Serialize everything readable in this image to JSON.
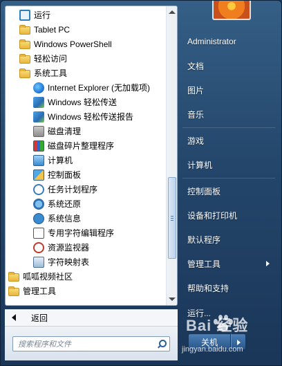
{
  "programs": [
    {
      "label": "运行",
      "icon": "run-icon",
      "indent": 0
    },
    {
      "label": "Tablet PC",
      "icon": "folder-icon",
      "indent": 0
    },
    {
      "label": "Windows PowerShell",
      "icon": "folder-icon",
      "indent": 0
    },
    {
      "label": "轻松访问",
      "icon": "folder-icon",
      "indent": 0
    },
    {
      "label": "系统工具",
      "icon": "folder-icon",
      "indent": 0
    },
    {
      "label": "Internet Explorer (无加载项)",
      "icon": "internet-explorer-icon",
      "indent": 1
    },
    {
      "label": "Windows 轻松传送",
      "icon": "easy-transfer-icon",
      "indent": 1
    },
    {
      "label": "Windows 轻松传送报告",
      "icon": "easy-transfer-report-icon",
      "indent": 1
    },
    {
      "label": "磁盘清理",
      "icon": "disk-cleanup-icon",
      "indent": 1
    },
    {
      "label": "磁盘碎片整理程序",
      "icon": "disk-defragmenter-icon",
      "indent": 1
    },
    {
      "label": "计算机",
      "icon": "computer-icon",
      "indent": 1
    },
    {
      "label": "控制面板",
      "icon": "control-panel-icon",
      "indent": 1
    },
    {
      "label": "任务计划程序",
      "icon": "task-scheduler-icon",
      "indent": 1
    },
    {
      "label": "系统还原",
      "icon": "system-restore-icon",
      "indent": 1
    },
    {
      "label": "系统信息",
      "icon": "system-information-icon",
      "indent": 1
    },
    {
      "label": "专用字符编辑程序",
      "icon": "private-character-editor-icon",
      "indent": 1
    },
    {
      "label": "资源监视器",
      "icon": "resource-monitor-icon",
      "indent": 1
    },
    {
      "label": "字符映射表",
      "icon": "character-map-icon",
      "indent": 1
    },
    {
      "label": "呱呱视频社区",
      "icon": "folder-icon",
      "indent": -1
    },
    {
      "label": "管理工具",
      "icon": "folder-icon",
      "indent": -1
    }
  ],
  "back_label": "返回",
  "search": {
    "placeholder": "搜索程序和文件"
  },
  "user": {
    "name": "Administrator"
  },
  "right_items": [
    {
      "label": "Administrator"
    },
    {
      "label": "文档"
    },
    {
      "label": "图片"
    },
    {
      "label": "音乐"
    },
    {
      "label": "游戏"
    },
    {
      "label": "计算机"
    },
    {
      "label": "控制面板"
    },
    {
      "label": "设备和打印机"
    },
    {
      "label": "默认程序"
    },
    {
      "label": "管理工具",
      "has_submenu": true
    },
    {
      "label": "帮助和支持"
    },
    {
      "label": "运行..."
    }
  ],
  "shutdown_label": "关机",
  "watermark": {
    "brand": "Bai 经验",
    "url": "jingyan.baidu.com"
  },
  "colors": {
    "accent": "#2a5589",
    "menu_bg": "#24466b"
  }
}
